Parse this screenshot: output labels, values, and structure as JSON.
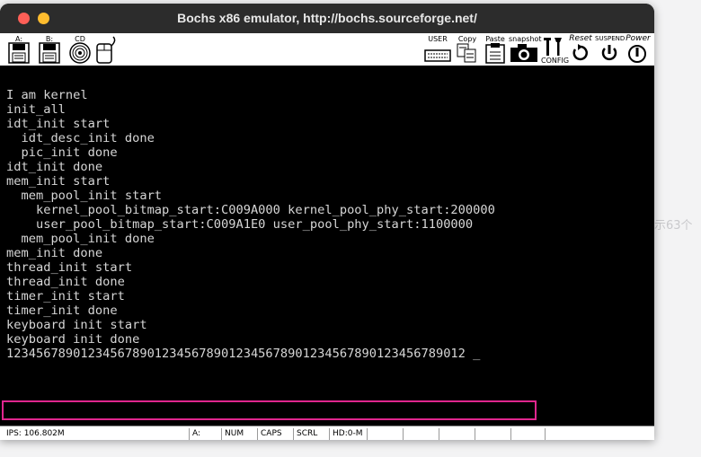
{
  "backdrop": {
    "text": "示63个"
  },
  "window": {
    "title": "Bochs x86 emulator, http://bochs.sourceforge.net/"
  },
  "toolbar": {
    "floppy_a_label": "A:",
    "floppy_b_label": "B:",
    "cdrom_label": "CD",
    "user_label": "USER",
    "copy_label": "Copy",
    "paste_label": "Paste",
    "snapshot_label": "snapshot",
    "config_label": "CONFIG",
    "reset_label": "Reset",
    "suspend_label": "SUSPEND",
    "power_label": "Power"
  },
  "console": {
    "lines": [
      "I am kernel",
      "init_all",
      "idt_init start",
      "  idt_desc_init done",
      "  pic_init done",
      "idt_init done",
      "mem_init start",
      "  mem_pool_init start",
      "    kernel_pool_bitmap_start:C009A000 kernel_pool_phy_start:200000",
      "    user_pool_bitmap_start:C009A1E0 user_pool_phy_start:1100000",
      "  mem_pool_init done",
      "mem_init done",
      "thread_init start",
      "thread_init done",
      "timer_init start",
      "timer_init done",
      "keyboard init start",
      "keyboard init done"
    ],
    "input_line": "12345678901234567890123456789012345678901234567890123456789012 _"
  },
  "status": {
    "ips": "IPS: 106.802M",
    "drive": "A:",
    "num": "NUM",
    "caps": "CAPS",
    "scrl": "SCRL",
    "hd": "HD:0-M"
  },
  "colors": {
    "highlight": "#e0268e",
    "console_text": "#d6d6d6",
    "titlebar": "#2c2c2c"
  }
}
